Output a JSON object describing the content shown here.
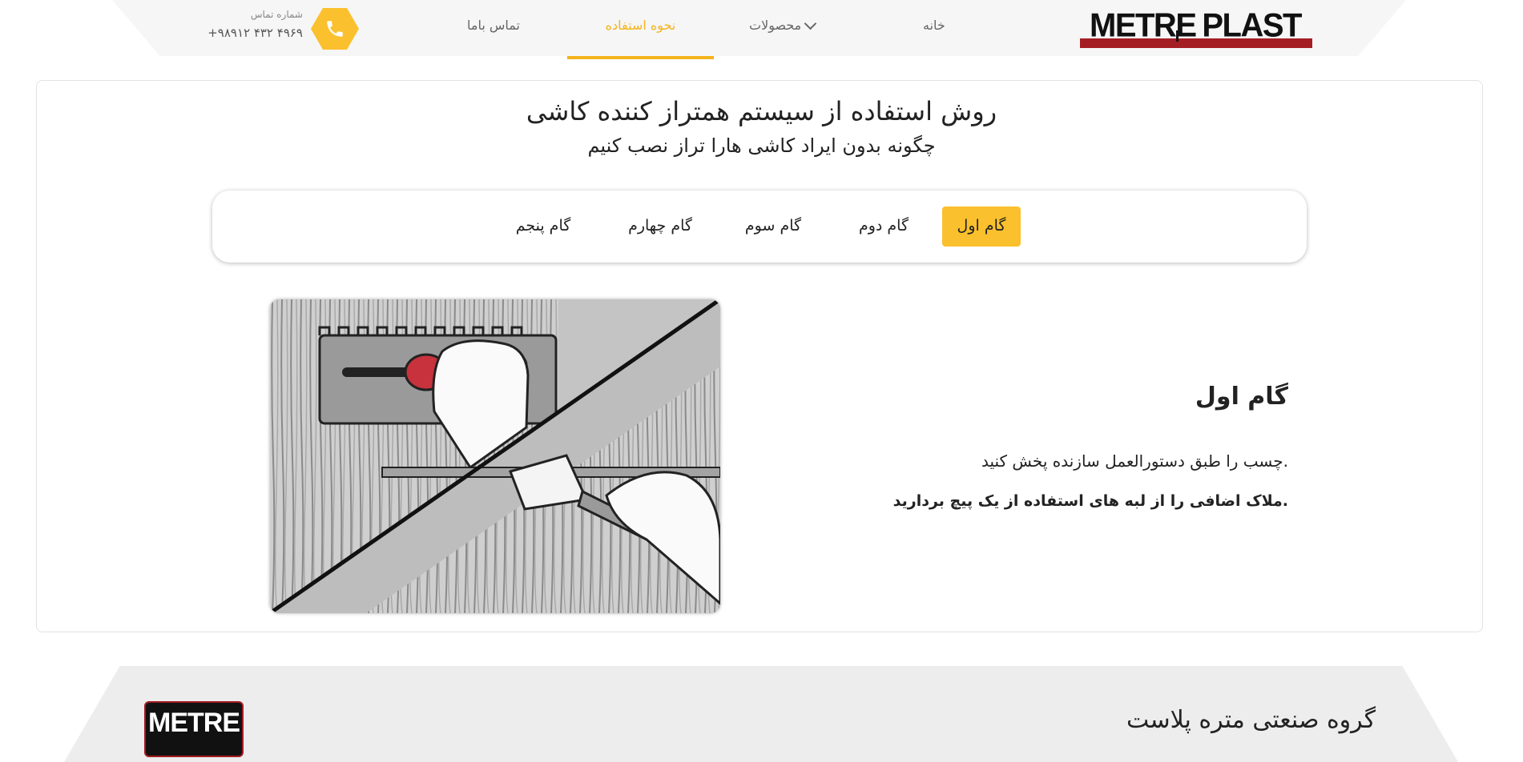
{
  "header": {
    "logo_word_1": "METRE",
    "logo_word_2": "PLAST",
    "nav": {
      "home": "خانه",
      "products": "محصولات",
      "usage": "نحوه استفاده",
      "contact": "تماس باما"
    },
    "active_nav": "usage",
    "phone_label": "شماره تماس",
    "phone_number": "+۹۸۹۱۲ ۴۳۲ ۴۹۶۹",
    "phone_icon": "phone-icon"
  },
  "main": {
    "title": "روش استفاده از سیستم همتراز کننده کاشی",
    "subtitle": "چگونه بدون ایراد کاشی هارا تراز نصب کنیم",
    "tabs": [
      {
        "label": "گام اول",
        "active": true
      },
      {
        "label": "گام دوم",
        "active": false
      },
      {
        "label": "گام سوم",
        "active": false
      },
      {
        "label": "گام چهارم",
        "active": false
      },
      {
        "label": "گام پنجم",
        "active": false
      }
    ],
    "step": {
      "heading": "گام اول",
      "description": "چسب را طبق دستورالعمل سازنده پخش کنید.",
      "note": "ملاک اضافی را از لبه های استفاده از یک پیچ بردارید."
    }
  },
  "footer": {
    "logo_text": "METRE",
    "title": "گروه صنعتی متره پلاست"
  },
  "colors": {
    "accent": "#fbc02d",
    "brand_red": "#a41d22",
    "header_bg": "#f6f6f6",
    "footer_bg": "#ededed"
  }
}
